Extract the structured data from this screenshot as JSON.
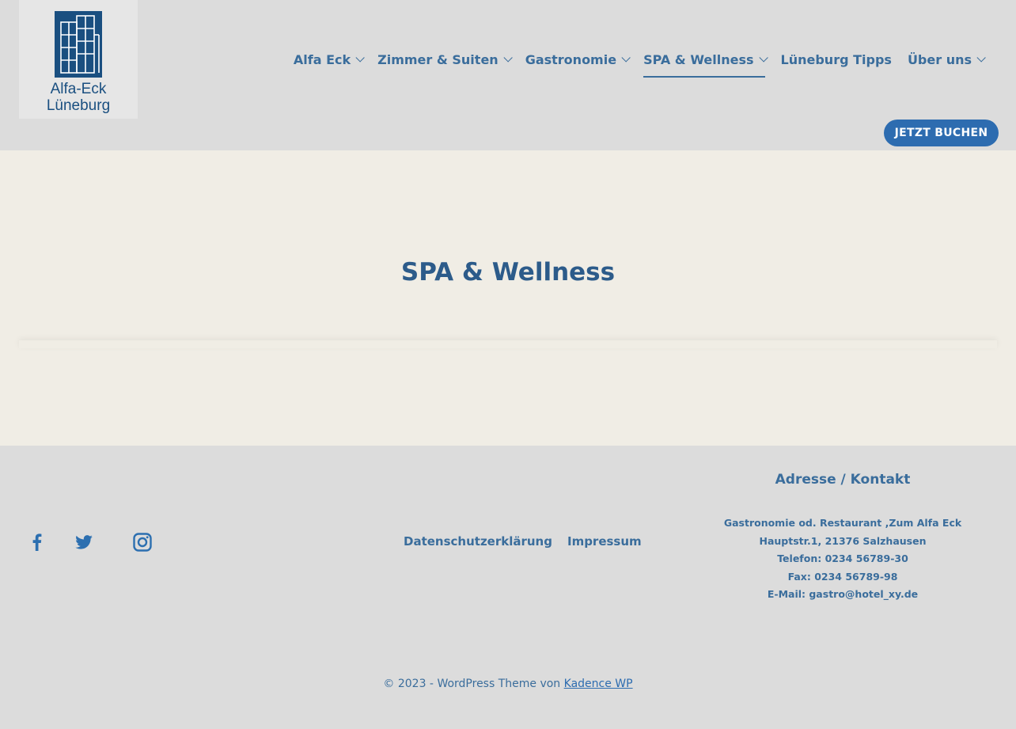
{
  "logo": {
    "line1": "Alfa-Eck",
    "line2": "Lüneburg"
  },
  "nav": {
    "items": [
      {
        "label": "Alfa Eck",
        "dropdown": true,
        "active": false
      },
      {
        "label": "Zimmer & Suiten",
        "dropdown": true,
        "active": false
      },
      {
        "label": "Gastronomie",
        "dropdown": true,
        "active": false
      },
      {
        "label": "SPA & Wellness",
        "dropdown": true,
        "active": true
      },
      {
        "label": "Lüneburg Tipps",
        "dropdown": false,
        "active": false
      },
      {
        "label": "Über uns",
        "dropdown": true,
        "active": false
      }
    ],
    "cta_label": "JETZT BUCHEN"
  },
  "hero": {
    "title": "SPA & Wellness"
  },
  "footer": {
    "social": [
      "facebook-icon",
      "twitter-icon",
      "instagram-icon"
    ],
    "links": [
      "Datenschutzerklärung",
      "Impressum"
    ],
    "contact": {
      "heading": "Adresse / Kontakt",
      "line1": "Gastronomie od. Restaurant ,Zum Alfa Eck",
      "line2": "Hauptstr.1, 21376 Salzhausen",
      "line3": "Telefon: 0234 56789-30",
      "line4": "Fax: 0234 56789-98",
      "line5": "E-Mail: gastro@hotel_xy.de"
    },
    "copyright_text": "© 2023 - WordPress Theme von ",
    "copyright_link": "Kadence WP"
  },
  "colors": {
    "accent": "#2d6cb0",
    "text": "#3a6d9c",
    "header_bg": "#dcdcdc",
    "page_bg": "#f0ede5"
  }
}
